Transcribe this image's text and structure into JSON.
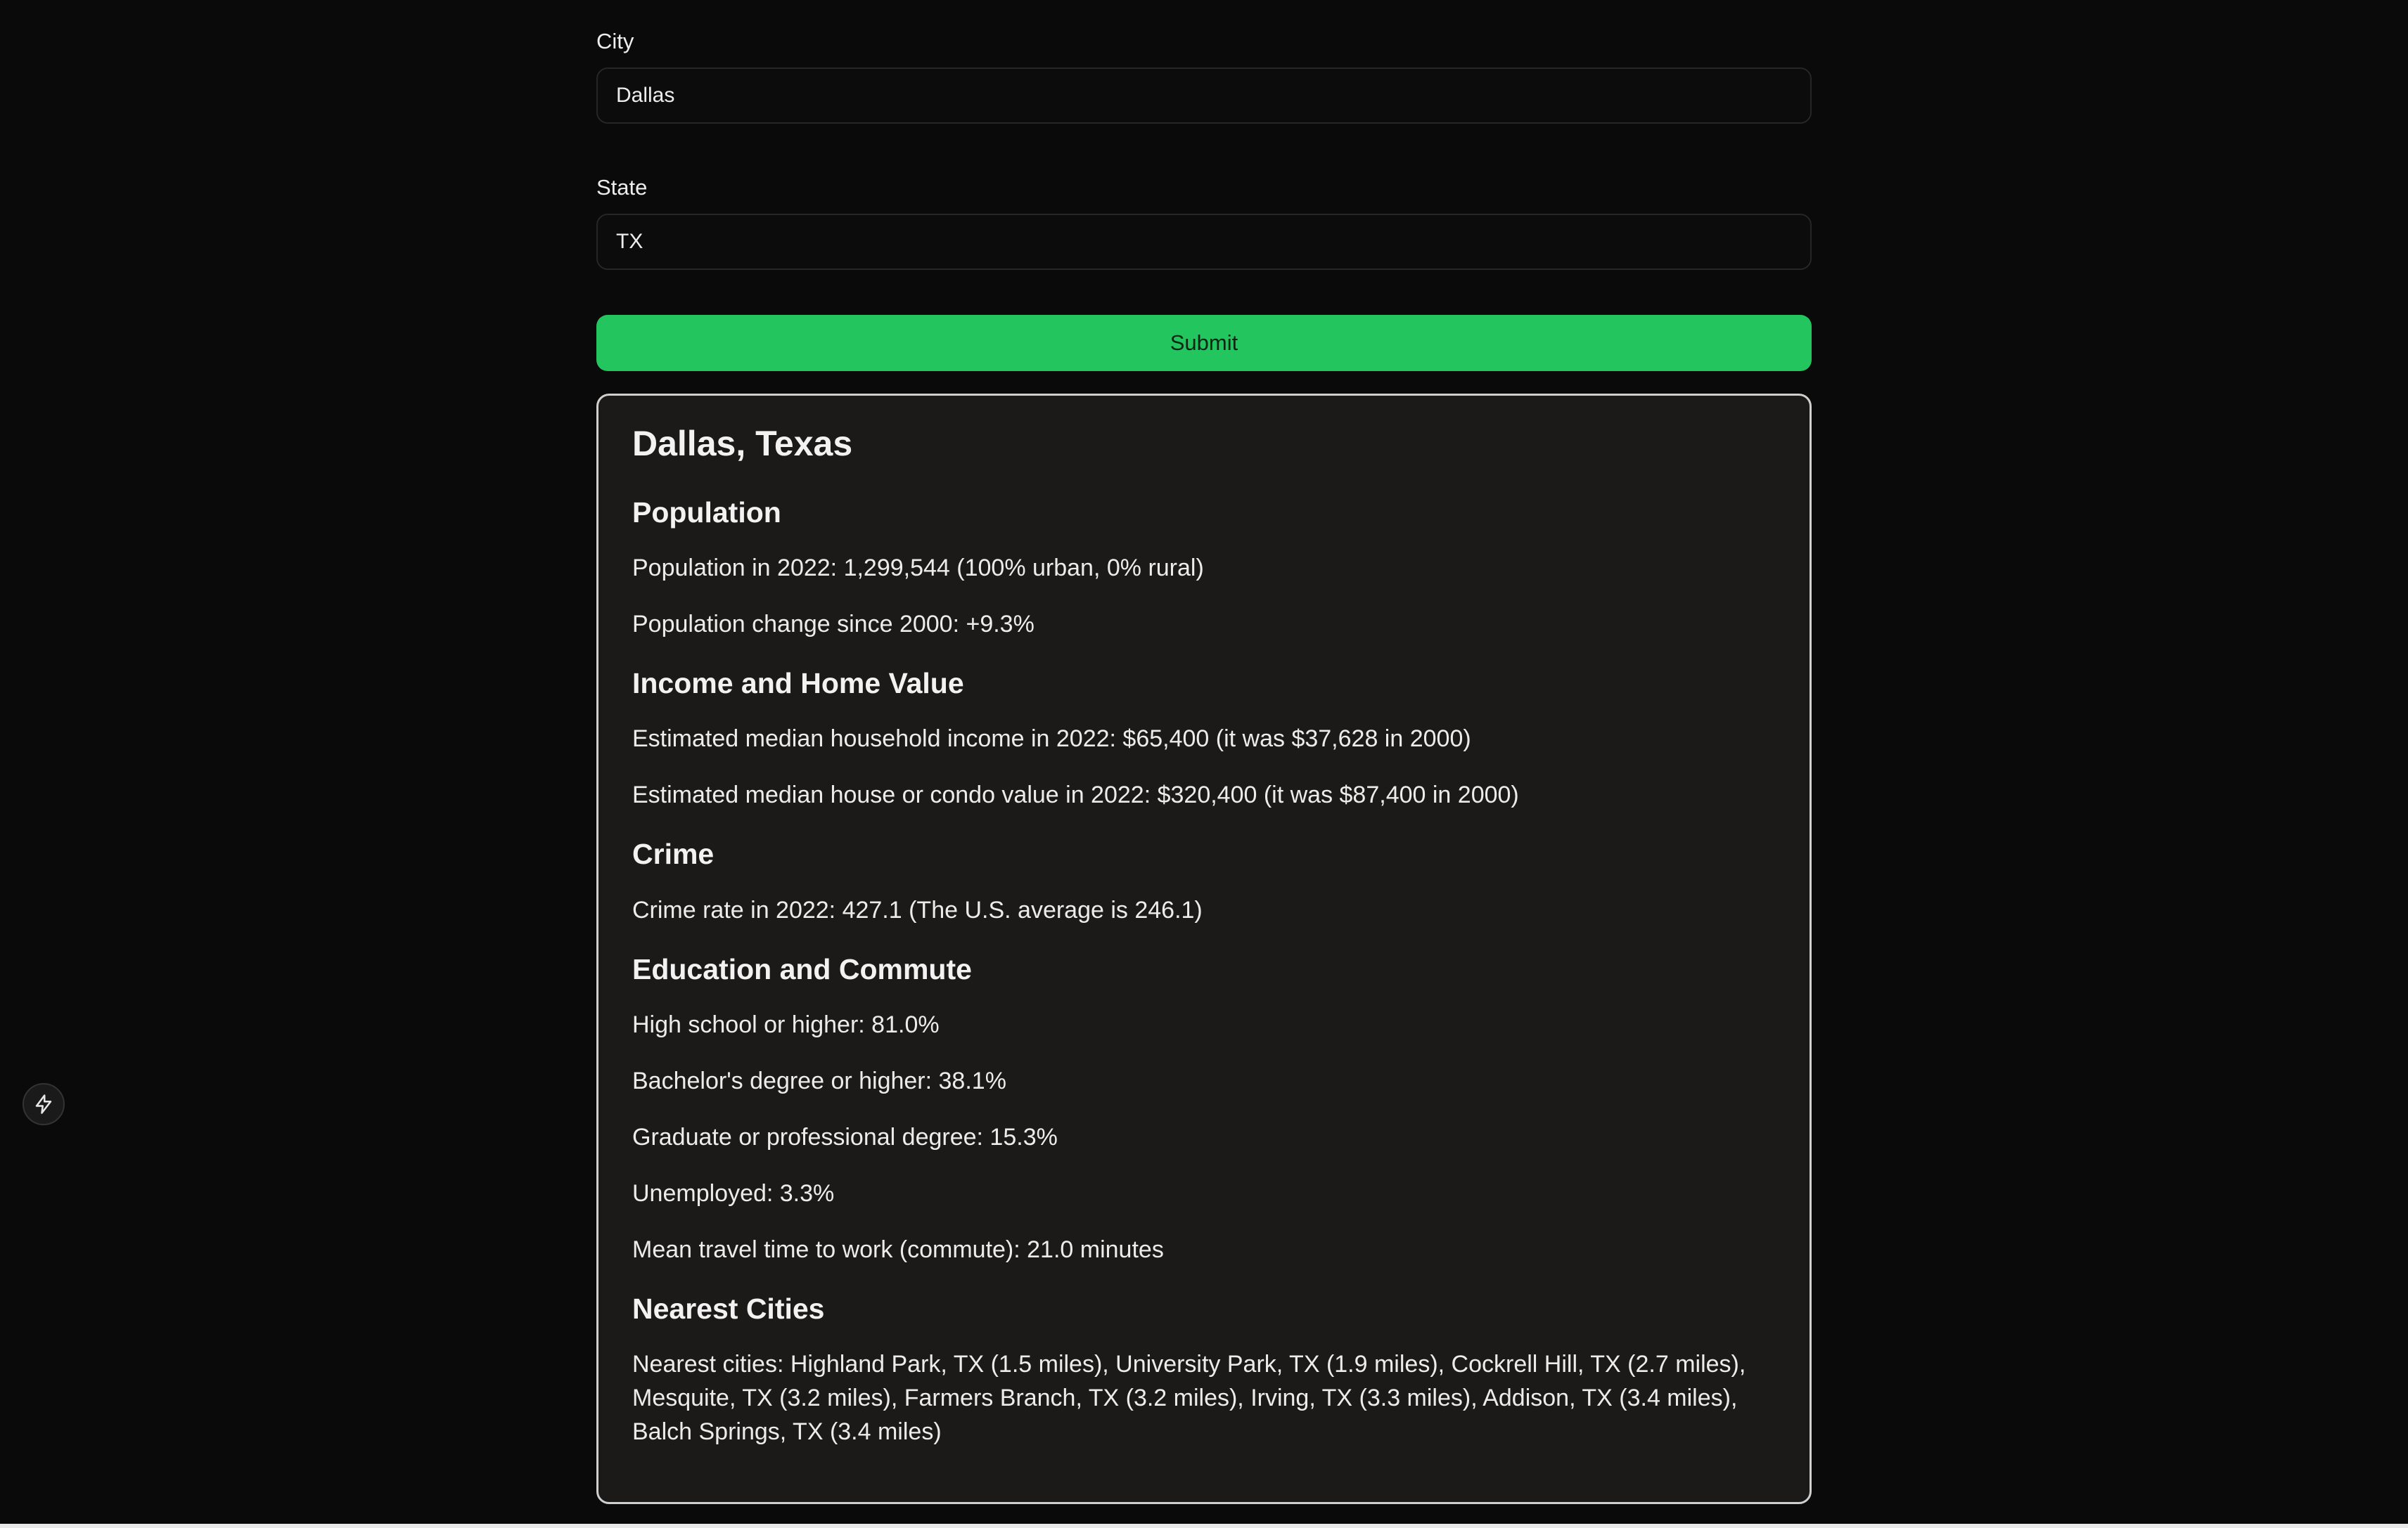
{
  "form": {
    "city_label": "City",
    "city_value": "Dallas",
    "state_label": "State",
    "state_value": "TX",
    "submit_label": "Submit"
  },
  "result": {
    "title": "Dallas, Texas",
    "population": {
      "heading": "Population",
      "line1": "Population in 2022: 1,299,544 (100% urban, 0% rural)",
      "line2": "Population change since 2000: +9.3%"
    },
    "income": {
      "heading": "Income and Home Value",
      "line1": "Estimated median household income in 2022: $65,400 (it was $37,628 in 2000)",
      "line2": "Estimated median house or condo value in 2022: $320,400 (it was $87,400 in 2000)"
    },
    "crime": {
      "heading": "Crime",
      "line1": "Crime rate in 2022: 427.1 (The U.S. average is 246.1)"
    },
    "education": {
      "heading": "Education and Commute",
      "line1": "High school or higher: 81.0%",
      "line2": "Bachelor's degree or higher: 38.1%",
      "line3": "Graduate or professional degree: 15.3%",
      "line4": "Unemployed: 3.3%",
      "line5": "Mean travel time to work (commute): 21.0 minutes"
    },
    "nearest": {
      "heading": "Nearest Cities",
      "line1": "Nearest cities: Highland Park, TX (1.5 miles), University Park, TX (1.9 miles), Cockrell Hill, TX (2.7 miles), Mesquite, TX (3.2 miles), Farmers Branch, TX (3.2 miles), Irving, TX (3.3 miles), Addison, TX (3.4 miles), Balch Springs, TX (3.4 miles)"
    }
  },
  "side_badge": {
    "icon": "lightning-icon"
  },
  "colors": {
    "background": "#0a0a0a",
    "submit_green": "#22c55e",
    "card_background": "#1c1a19"
  }
}
